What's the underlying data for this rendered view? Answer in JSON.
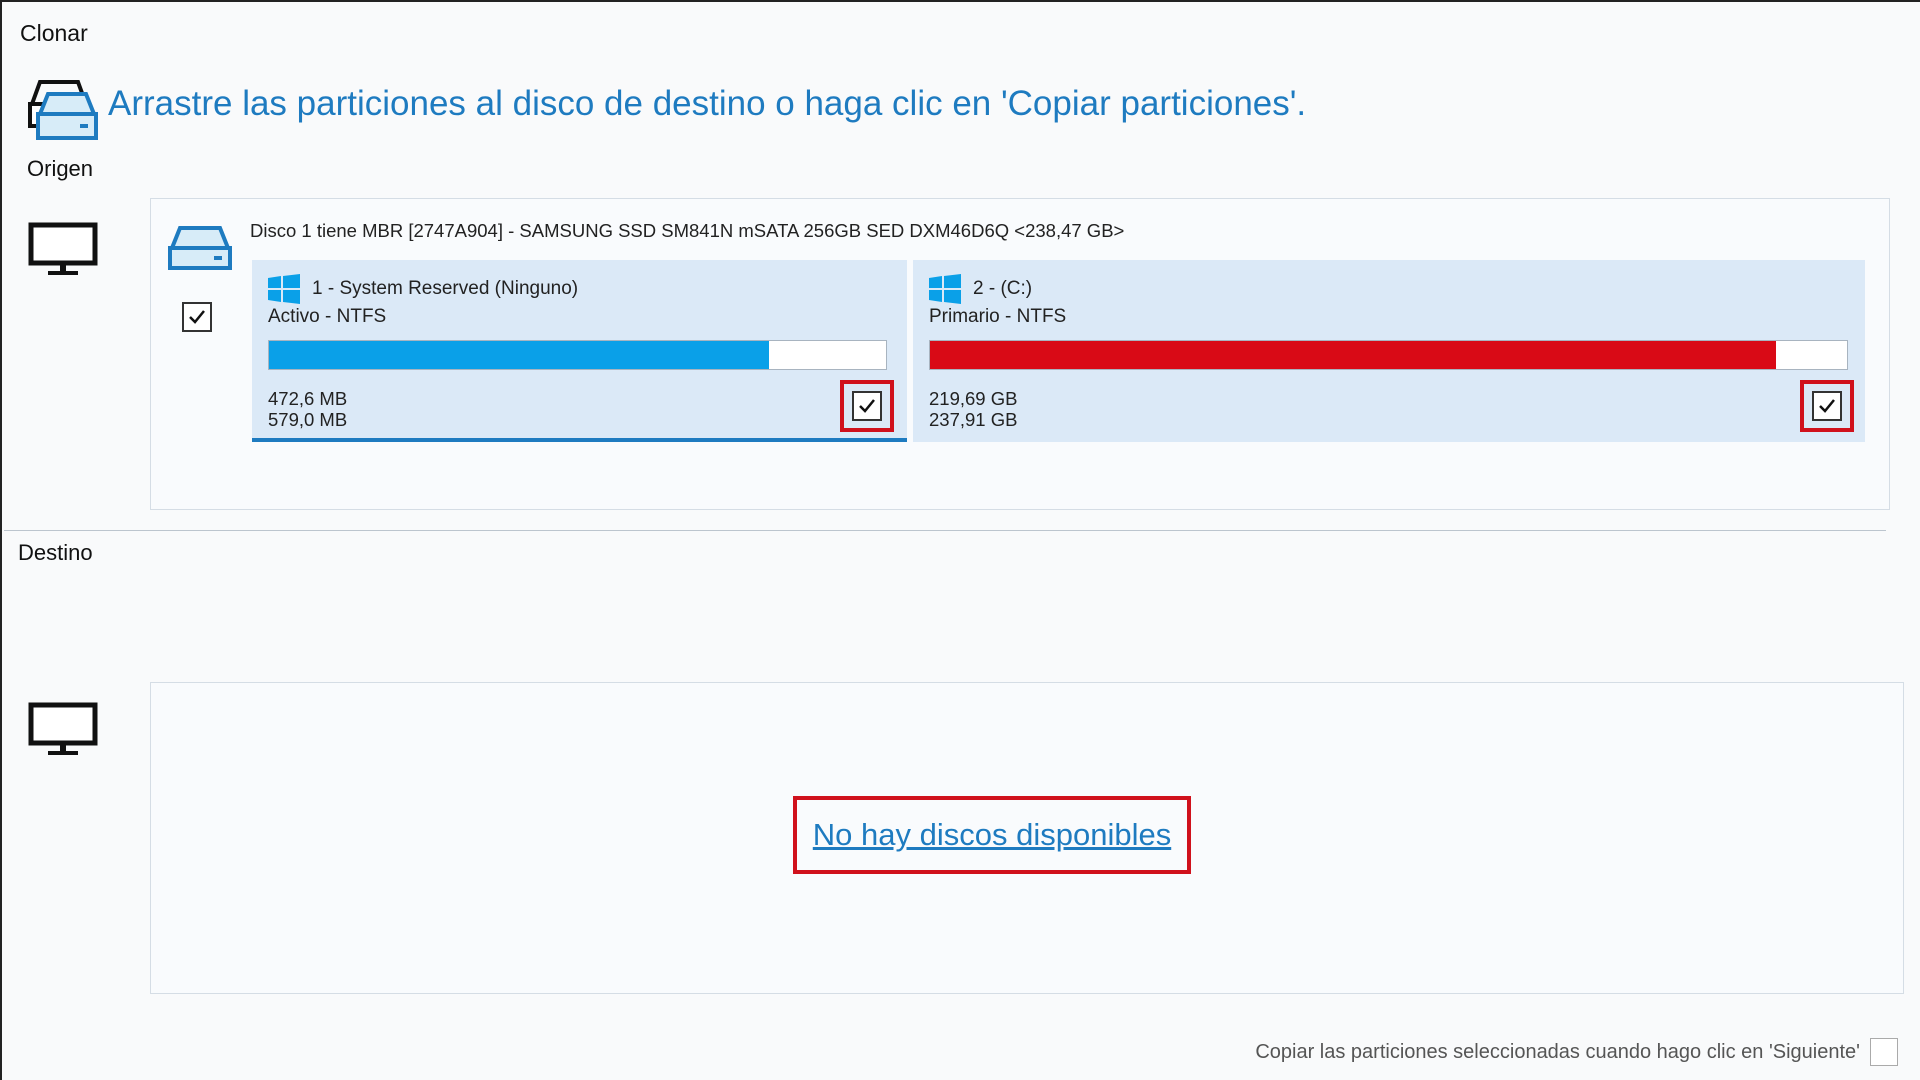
{
  "window": {
    "title": "Clonar"
  },
  "header": {
    "instruction": "Arrastre las particiones al disco de destino o haga clic en 'Copiar particiones'."
  },
  "source": {
    "label": "Origen",
    "disk": {
      "title": "Disco 1 tiene MBR [2747A904] - SAMSUNG SSD SM841N mSATA 256GB SED DXM46D6Q  <238,47 GB>",
      "checked": true,
      "partitions": [
        {
          "name": "1 - System Reserved (Ninguno)",
          "type": "Activo - NTFS",
          "used": "472,6 MB",
          "total": "579,0 MB",
          "fill_fraction": 0.81,
          "fill_color": "#0aa0e8",
          "checked": true,
          "selected": true
        },
        {
          "name": "2 -  (C:)",
          "type": "Primario - NTFS",
          "used": "219,69 GB",
          "total": "237,91 GB",
          "fill_fraction": 0.923,
          "fill_color": "#d90a16",
          "checked": true,
          "selected": false
        }
      ]
    }
  },
  "destination": {
    "label": "Destino",
    "no_disks_link": "No hay discos disponibles"
  },
  "footer": {
    "copy_on_next_label": "Copiar las particiones seleccionadas cuando hago clic en 'Siguiente'",
    "copy_on_next_checked": false
  },
  "colors": {
    "accent": "#1e7bc0",
    "highlight": "#d0111c",
    "partition_bg": "#dbe9f7"
  },
  "icons": {
    "header": "disk-clone-icon",
    "source_computer": "monitor-icon",
    "source_disk": "hard-disk-icon",
    "partition": "windows-logo-icon",
    "destination_computer": "monitor-icon"
  }
}
